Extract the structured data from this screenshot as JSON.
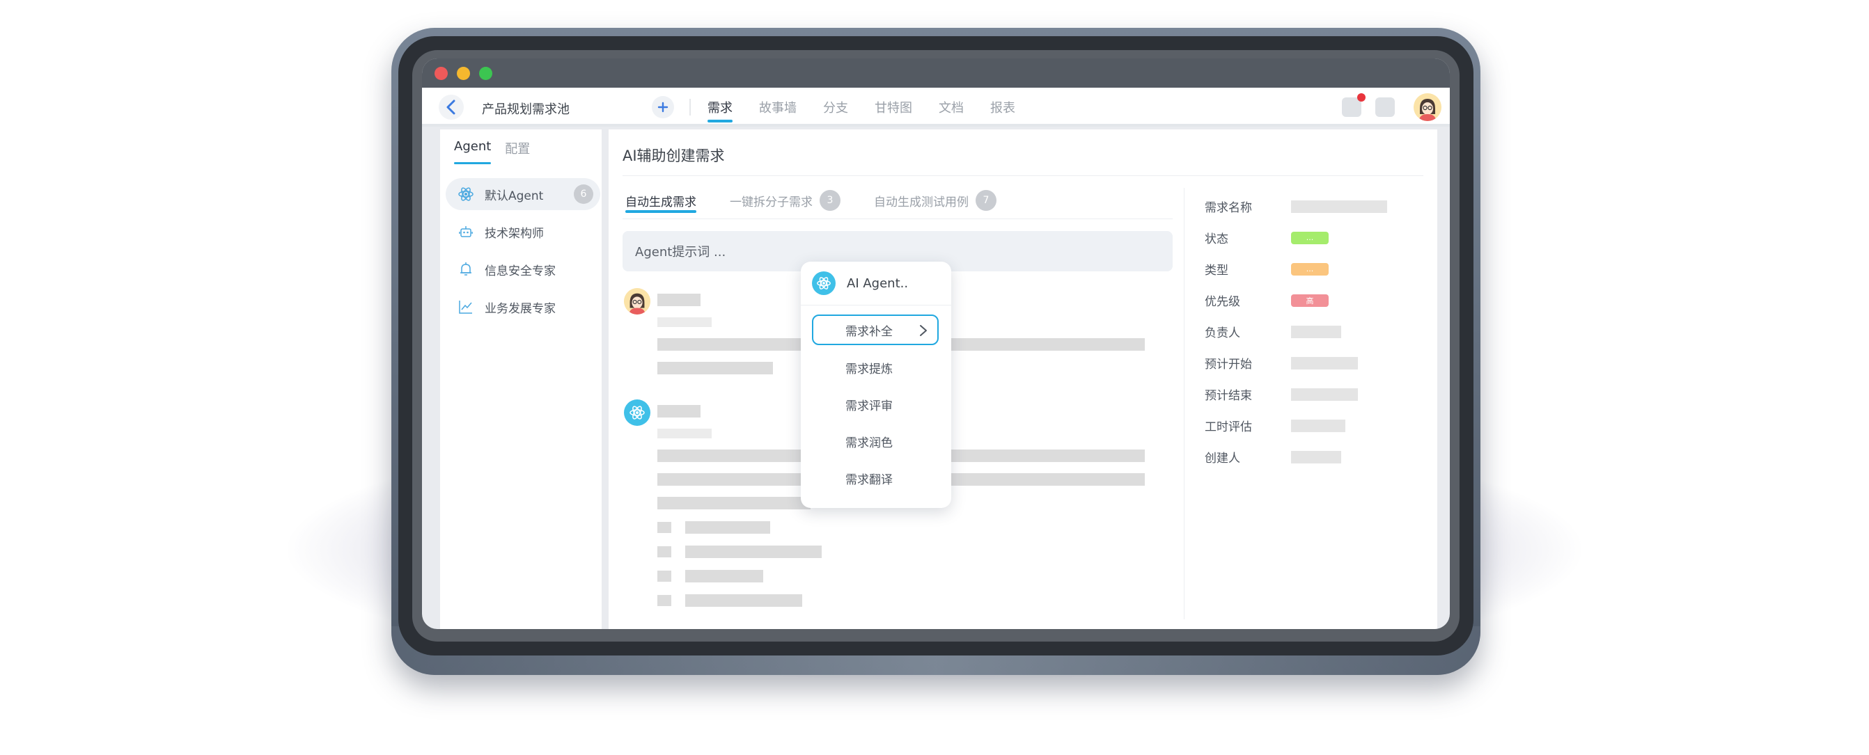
{
  "window": {
    "project_title": "产品规划需求池",
    "nav_tabs": [
      "需求",
      "故事墙",
      "分支",
      "甘特图",
      "文档",
      "报表"
    ]
  },
  "sidebar": {
    "tabs": [
      "Agent",
      "配置"
    ],
    "items": [
      {
        "label": "默认Agent",
        "badge": "6",
        "icon": "atom-icon"
      },
      {
        "label": "技术架构师",
        "icon": "robot-icon"
      },
      {
        "label": "信息安全专家",
        "icon": "bell-shield-icon"
      },
      {
        "label": "业务发展专家",
        "icon": "trend-chart-icon"
      }
    ]
  },
  "main": {
    "title": "AI辅助创建需求",
    "tabs": [
      {
        "label": "自动生成需求"
      },
      {
        "label": "一键拆分子需求",
        "count": "3"
      },
      {
        "label": "自动生成测试用例",
        "count": "7"
      }
    ],
    "prompt_placeholder": "Agent提示词 ..."
  },
  "details": {
    "labels": [
      "需求名称",
      "状态",
      "类型",
      "优先级",
      "负责人",
      "预计开始",
      "预计结束",
      "工时评估",
      "创建人"
    ],
    "status_pill": "...",
    "type_pill": "...",
    "priority_pill": "高"
  },
  "popup": {
    "title": "AI Agent..",
    "items": [
      "需求补全",
      "需求提炼",
      "需求评审",
      "需求润色",
      "需求翻译"
    ],
    "active_item": "需求补全"
  },
  "colors": {
    "accent": "#21a8e0",
    "status_green": "#a5ec6c",
    "type_orange": "#fbc57e",
    "priority_red": "#f29097"
  }
}
